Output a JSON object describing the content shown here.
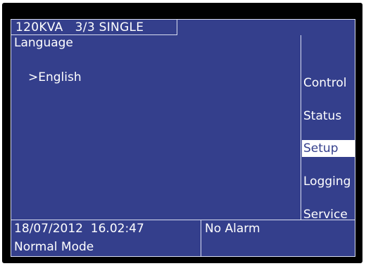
{
  "header": {
    "title": "120KVA   3/3 SINGLE"
  },
  "main": {
    "title": "Language",
    "selected_option": ">English"
  },
  "menu": {
    "items": [
      {
        "label": "Control"
      },
      {
        "label": "Status"
      },
      {
        "label": "Setup"
      },
      {
        "label": "Logging"
      },
      {
        "label": "Service"
      }
    ],
    "active": "Setup"
  },
  "footer": {
    "datetime": "18/07/2012  16.02:47",
    "mode": "Normal Mode",
    "alarm": "No Alarm"
  },
  "colors": {
    "screen_background": "#343f8c",
    "text": "#ffffff",
    "bezel": "#000000",
    "highlight_background": "#ffffff"
  }
}
